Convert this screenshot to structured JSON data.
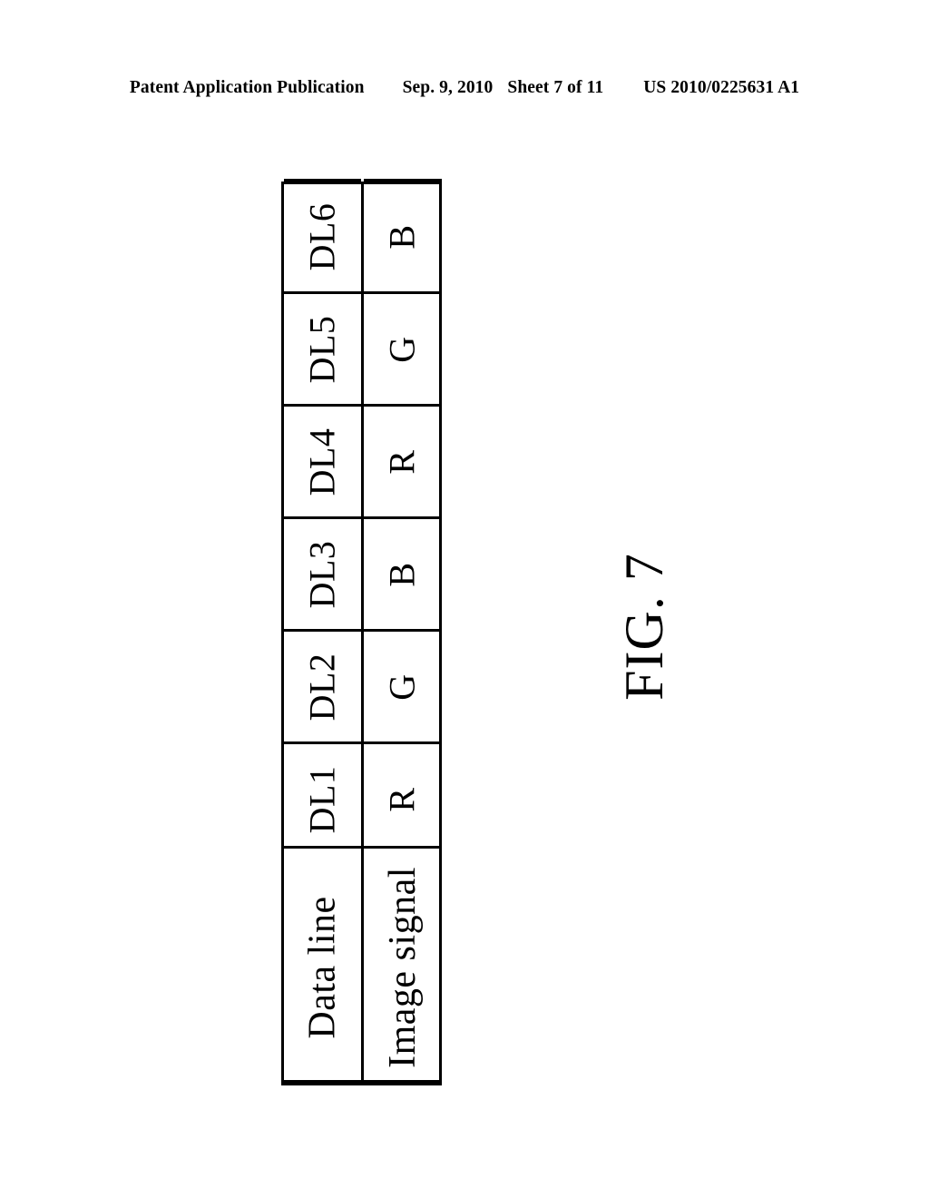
{
  "header": {
    "publication": "Patent Application Publication",
    "date": "Sep. 9, 2010",
    "sheet": "Sheet 7 of 11",
    "publication_number": "US 2010/0225631 A1"
  },
  "figure": {
    "caption": "FIG. 7"
  },
  "chart_data": {
    "type": "table",
    "title": "FIG. 7",
    "orientation": "rotated-90-ccw",
    "row_headers": [
      "Data line",
      "Image signal"
    ],
    "columns": [
      "DL1",
      "DL2",
      "DL3",
      "DL4",
      "DL5",
      "DL6"
    ],
    "rows": [
      {
        "header": "Data line",
        "values": [
          "DL1",
          "DL2",
          "DL3",
          "DL4",
          "DL5",
          "DL6"
        ]
      },
      {
        "header": "Image signal",
        "values": [
          "R",
          "G",
          "B",
          "R",
          "G",
          "B"
        ]
      }
    ],
    "grid": true,
    "border_color": "#000000",
    "background_color": "#ffffff"
  }
}
